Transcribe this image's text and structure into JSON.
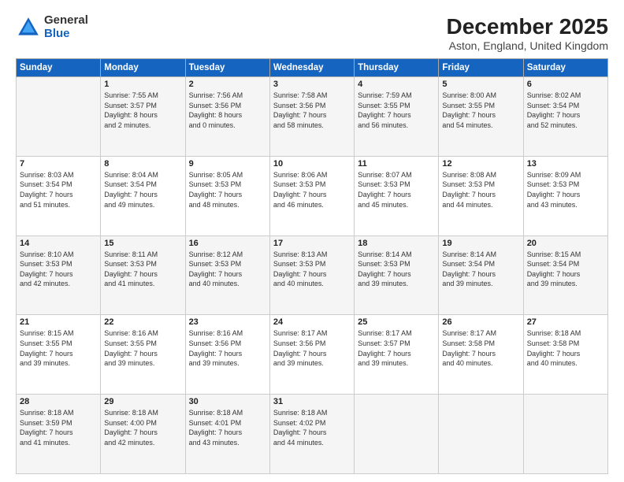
{
  "logo": {
    "general": "General",
    "blue": "Blue"
  },
  "header": {
    "month": "December 2025",
    "location": "Aston, England, United Kingdom"
  },
  "weekdays": [
    "Sunday",
    "Monday",
    "Tuesday",
    "Wednesday",
    "Thursday",
    "Friday",
    "Saturday"
  ],
  "weeks": [
    [
      {
        "day": "",
        "info": ""
      },
      {
        "day": "1",
        "info": "Sunrise: 7:55 AM\nSunset: 3:57 PM\nDaylight: 8 hours\nand 2 minutes."
      },
      {
        "day": "2",
        "info": "Sunrise: 7:56 AM\nSunset: 3:56 PM\nDaylight: 8 hours\nand 0 minutes."
      },
      {
        "day": "3",
        "info": "Sunrise: 7:58 AM\nSunset: 3:56 PM\nDaylight: 7 hours\nand 58 minutes."
      },
      {
        "day": "4",
        "info": "Sunrise: 7:59 AM\nSunset: 3:55 PM\nDaylight: 7 hours\nand 56 minutes."
      },
      {
        "day": "5",
        "info": "Sunrise: 8:00 AM\nSunset: 3:55 PM\nDaylight: 7 hours\nand 54 minutes."
      },
      {
        "day": "6",
        "info": "Sunrise: 8:02 AM\nSunset: 3:54 PM\nDaylight: 7 hours\nand 52 minutes."
      }
    ],
    [
      {
        "day": "7",
        "info": "Sunrise: 8:03 AM\nSunset: 3:54 PM\nDaylight: 7 hours\nand 51 minutes."
      },
      {
        "day": "8",
        "info": "Sunrise: 8:04 AM\nSunset: 3:54 PM\nDaylight: 7 hours\nand 49 minutes."
      },
      {
        "day": "9",
        "info": "Sunrise: 8:05 AM\nSunset: 3:53 PM\nDaylight: 7 hours\nand 48 minutes."
      },
      {
        "day": "10",
        "info": "Sunrise: 8:06 AM\nSunset: 3:53 PM\nDaylight: 7 hours\nand 46 minutes."
      },
      {
        "day": "11",
        "info": "Sunrise: 8:07 AM\nSunset: 3:53 PM\nDaylight: 7 hours\nand 45 minutes."
      },
      {
        "day": "12",
        "info": "Sunrise: 8:08 AM\nSunset: 3:53 PM\nDaylight: 7 hours\nand 44 minutes."
      },
      {
        "day": "13",
        "info": "Sunrise: 8:09 AM\nSunset: 3:53 PM\nDaylight: 7 hours\nand 43 minutes."
      }
    ],
    [
      {
        "day": "14",
        "info": "Sunrise: 8:10 AM\nSunset: 3:53 PM\nDaylight: 7 hours\nand 42 minutes."
      },
      {
        "day": "15",
        "info": "Sunrise: 8:11 AM\nSunset: 3:53 PM\nDaylight: 7 hours\nand 41 minutes."
      },
      {
        "day": "16",
        "info": "Sunrise: 8:12 AM\nSunset: 3:53 PM\nDaylight: 7 hours\nand 40 minutes."
      },
      {
        "day": "17",
        "info": "Sunrise: 8:13 AM\nSunset: 3:53 PM\nDaylight: 7 hours\nand 40 minutes."
      },
      {
        "day": "18",
        "info": "Sunrise: 8:14 AM\nSunset: 3:53 PM\nDaylight: 7 hours\nand 39 minutes."
      },
      {
        "day": "19",
        "info": "Sunrise: 8:14 AM\nSunset: 3:54 PM\nDaylight: 7 hours\nand 39 minutes."
      },
      {
        "day": "20",
        "info": "Sunrise: 8:15 AM\nSunset: 3:54 PM\nDaylight: 7 hours\nand 39 minutes."
      }
    ],
    [
      {
        "day": "21",
        "info": "Sunrise: 8:15 AM\nSunset: 3:55 PM\nDaylight: 7 hours\nand 39 minutes."
      },
      {
        "day": "22",
        "info": "Sunrise: 8:16 AM\nSunset: 3:55 PM\nDaylight: 7 hours\nand 39 minutes."
      },
      {
        "day": "23",
        "info": "Sunrise: 8:16 AM\nSunset: 3:56 PM\nDaylight: 7 hours\nand 39 minutes."
      },
      {
        "day": "24",
        "info": "Sunrise: 8:17 AM\nSunset: 3:56 PM\nDaylight: 7 hours\nand 39 minutes."
      },
      {
        "day": "25",
        "info": "Sunrise: 8:17 AM\nSunset: 3:57 PM\nDaylight: 7 hours\nand 39 minutes."
      },
      {
        "day": "26",
        "info": "Sunrise: 8:17 AM\nSunset: 3:58 PM\nDaylight: 7 hours\nand 40 minutes."
      },
      {
        "day": "27",
        "info": "Sunrise: 8:18 AM\nSunset: 3:58 PM\nDaylight: 7 hours\nand 40 minutes."
      }
    ],
    [
      {
        "day": "28",
        "info": "Sunrise: 8:18 AM\nSunset: 3:59 PM\nDaylight: 7 hours\nand 41 minutes."
      },
      {
        "day": "29",
        "info": "Sunrise: 8:18 AM\nSunset: 4:00 PM\nDaylight: 7 hours\nand 42 minutes."
      },
      {
        "day": "30",
        "info": "Sunrise: 8:18 AM\nSunset: 4:01 PM\nDaylight: 7 hours\nand 43 minutes."
      },
      {
        "day": "31",
        "info": "Sunrise: 8:18 AM\nSunset: 4:02 PM\nDaylight: 7 hours\nand 44 minutes."
      },
      {
        "day": "",
        "info": ""
      },
      {
        "day": "",
        "info": ""
      },
      {
        "day": "",
        "info": ""
      }
    ]
  ]
}
